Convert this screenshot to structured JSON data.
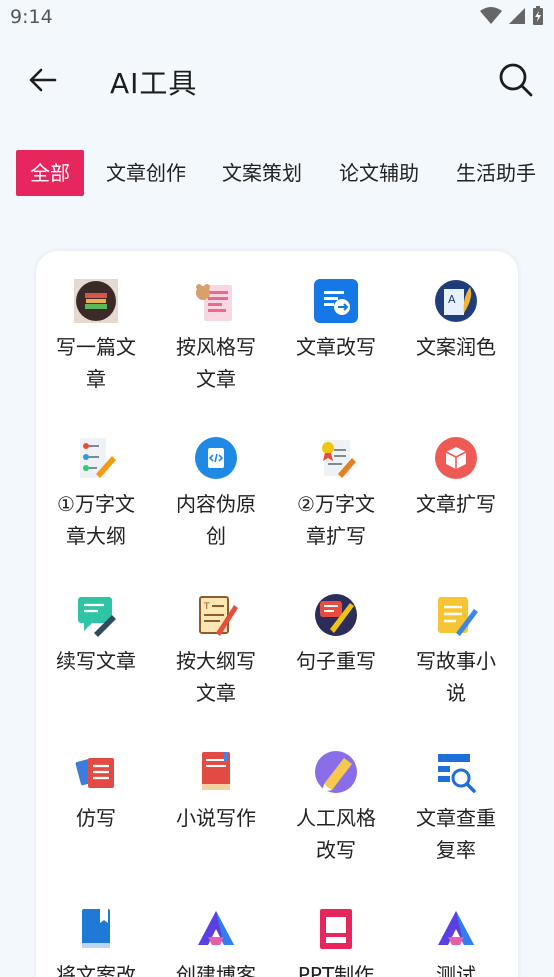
{
  "status": {
    "time": "9:14"
  },
  "header": {
    "title": "AI工具"
  },
  "tabs": [
    {
      "label": "全部",
      "active": true
    },
    {
      "label": "文章创作",
      "active": false
    },
    {
      "label": "文案策划",
      "active": false
    },
    {
      "label": "论文辅助",
      "active": false
    },
    {
      "label": "生活助手",
      "active": false
    }
  ],
  "tools": [
    {
      "label": "写一篇文章",
      "icon": "book-stack-icon"
    },
    {
      "label": "按风格写文章",
      "icon": "newspaper-bear-icon"
    },
    {
      "label": "文章改写",
      "icon": "document-refresh-icon"
    },
    {
      "label": "文案润色",
      "icon": "paper-feather-icon"
    },
    {
      "label": "①万字文章大纲",
      "icon": "outline-pencil-icon"
    },
    {
      "label": "内容伪原创",
      "icon": "code-doc-icon"
    },
    {
      "label": "②万字文章扩写",
      "icon": "certificate-pencil-icon"
    },
    {
      "label": "文章扩写",
      "icon": "cube-icon"
    },
    {
      "label": "续写文章",
      "icon": "chat-pencil-icon"
    },
    {
      "label": "按大纲写文章",
      "icon": "notepad-pencil-icon"
    },
    {
      "label": "句子重写",
      "icon": "chat-pen-circle-icon"
    },
    {
      "label": "写故事小说",
      "icon": "note-pencil-icon"
    },
    {
      "label": "仿写",
      "icon": "cards-icon"
    },
    {
      "label": "小说写作",
      "icon": "red-book-icon"
    },
    {
      "label": "人工风格改写",
      "icon": "pen-circle-icon"
    },
    {
      "label": "文章查重复率",
      "icon": "doc-search-icon"
    },
    {
      "label": "将文案改",
      "icon": "blue-book-icon"
    },
    {
      "label": "创建博客",
      "icon": "ai-logo-icon"
    },
    {
      "label": "PPT制作",
      "icon": "ppt-icon"
    },
    {
      "label": "测试",
      "icon": "ai-logo-icon"
    }
  ],
  "colors": {
    "accent": "#e8265e",
    "background": "#f3f8fd"
  }
}
